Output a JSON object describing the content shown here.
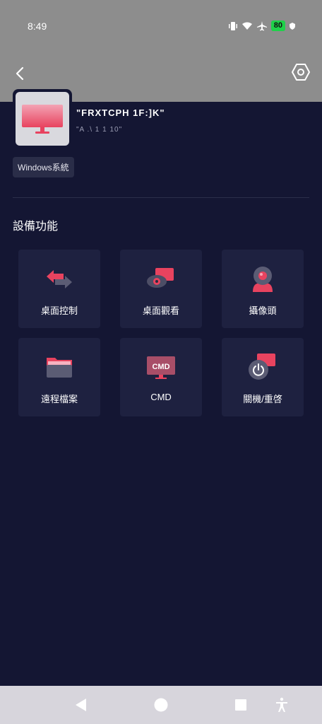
{
  "status_bar": {
    "time": "8:49",
    "battery": "80"
  },
  "device": {
    "name": "\"FRXTCPH 1F:]K\"",
    "sub": "\"A .\\ 1 1 10\"",
    "os_badge": "Windows系統"
  },
  "section_title": "設備功能",
  "functions": [
    {
      "label": "桌面控制",
      "icon": "desktop-control-icon"
    },
    {
      "label": "桌面觀看",
      "icon": "desktop-view-icon"
    },
    {
      "label": "攝像頭",
      "icon": "camera-icon"
    },
    {
      "label": "遠程檔案",
      "icon": "folder-icon"
    },
    {
      "label": "CMD",
      "icon": "cmd-icon",
      "icon_text": "CMD"
    },
    {
      "label": "關機/重啓",
      "icon": "power-icon"
    }
  ],
  "colors": {
    "accent": "#e8435f",
    "background": "#141633",
    "tile": "#1e2140",
    "header": "#8d8d8d"
  }
}
